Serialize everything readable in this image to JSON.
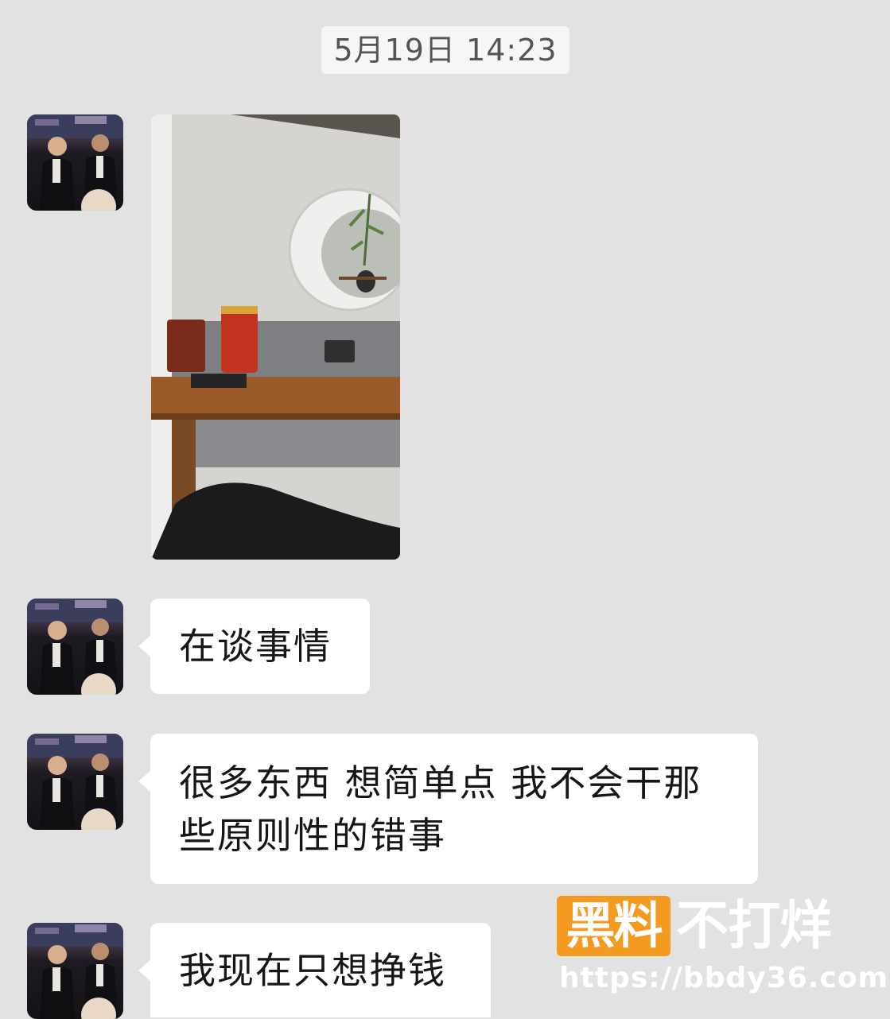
{
  "chat": {
    "timestamp": "5月19日 14:23",
    "messages": [
      {
        "type": "image",
        "content": "photo"
      },
      {
        "type": "text",
        "lines": [
          "在谈事情"
        ]
      },
      {
        "type": "text",
        "lines": [
          "很多东西 想简单点 我不会干那",
          "些原则性的错事"
        ]
      },
      {
        "type": "text",
        "lines": [
          "我现在只想挣钱"
        ]
      }
    ]
  },
  "watermark": {
    "badge": "黑料",
    "text": "不打烊",
    "url": "https://bbdy36.com",
    "badge_color": "#f49a20"
  },
  "colors": {
    "background": "#e2e2e2",
    "bubble": "#ffffff",
    "timestamp_bg": "#f6f6f6"
  }
}
